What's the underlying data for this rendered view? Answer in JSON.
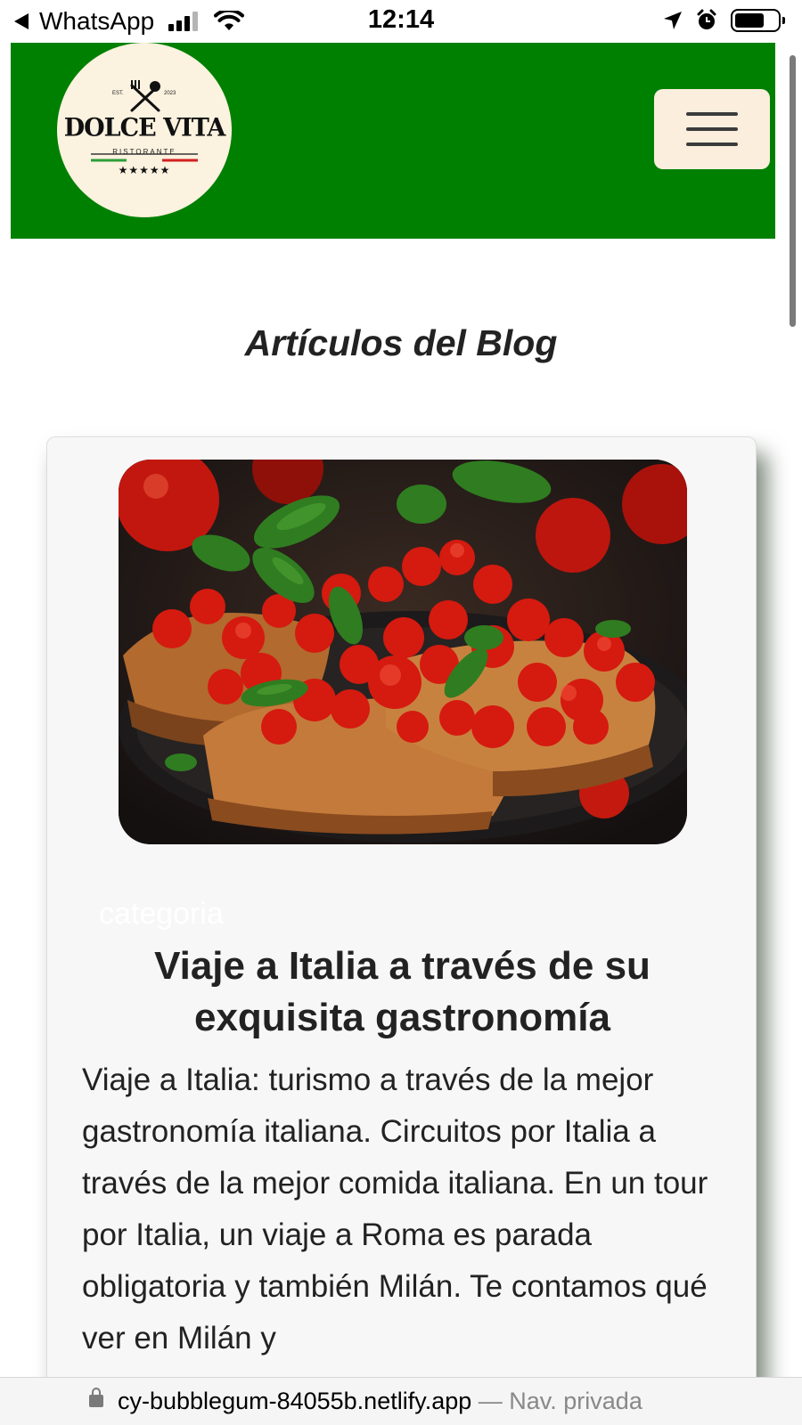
{
  "status_bar": {
    "back_app": "WhatsApp",
    "time": "12:14",
    "battery_level": 0.7
  },
  "header": {
    "logo": {
      "title": "DOLCE VITA",
      "subtitle": "RISTORANTE",
      "est": "EST.",
      "year": "2023",
      "stars": "★★★★★"
    },
    "menu_icon": "hamburger-icon",
    "colors": {
      "background": "#008000",
      "menu_button": "#fbeedd"
    }
  },
  "blog": {
    "heading": "Artículos del Blog",
    "article": {
      "image_icon": "bruschetta-photo",
      "category": "categoria",
      "title": "Viaje a Italia a través de su exquisita gastronomía",
      "excerpt": "Viaje a Italia: turismo a través de la mejor gastronomía italiana. Circuitos por Italia a través de la mejor comida italiana. En un tour por Italia, un viaje a Roma es parada obligatoria y también Milán. Te contamos qué ver en Milán y"
    }
  },
  "browser": {
    "url": "cy-bubblegum-84055b.netlify.app",
    "mode": " — Nav. privada"
  }
}
